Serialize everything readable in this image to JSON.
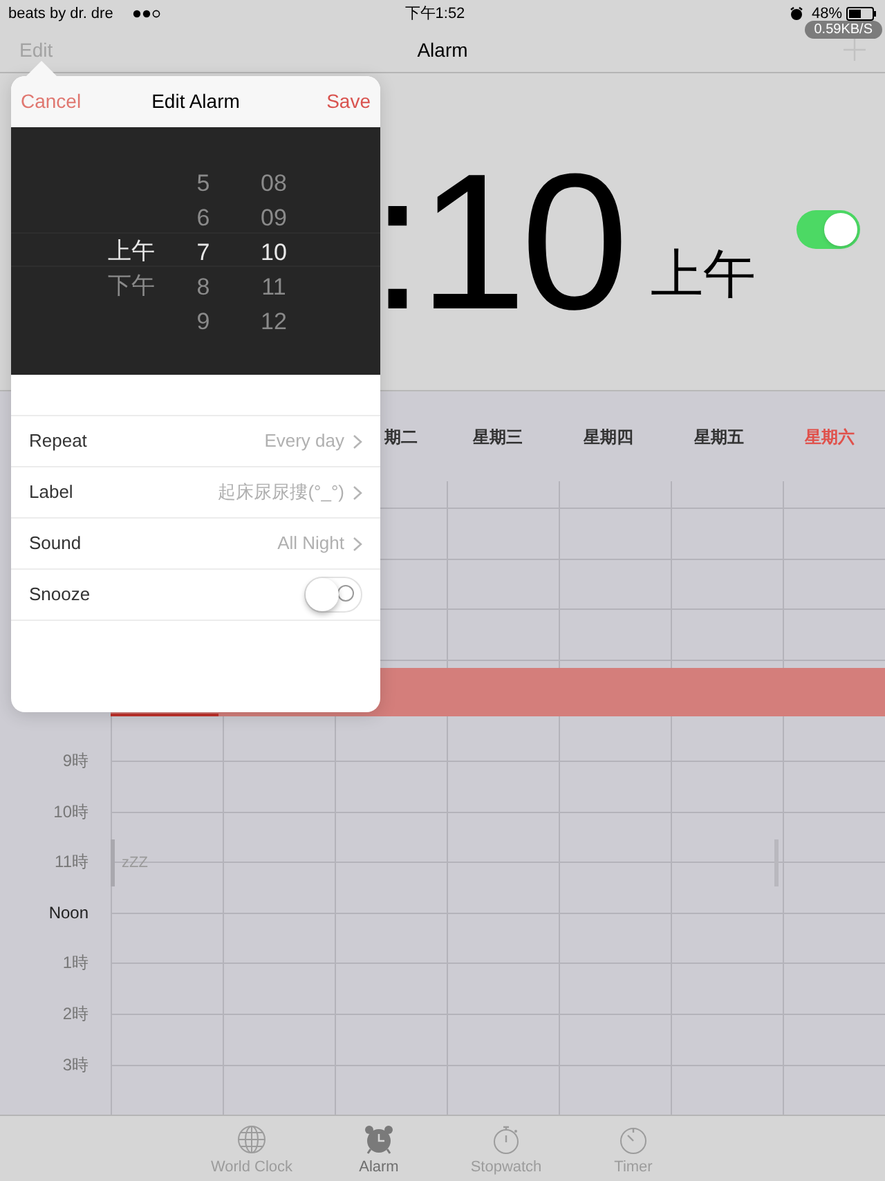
{
  "status_bar": {
    "carrier": "beats by dr. dre",
    "time": "下午1:52",
    "battery": "48%",
    "network_speed": "0.59KB/S"
  },
  "nav_bar": {
    "edit": "Edit",
    "title": "Alarm"
  },
  "alarm": {
    "time": ":10",
    "period": "上午",
    "on": true
  },
  "schedule": {
    "days": [
      {
        "label": "期二",
        "today": false
      },
      {
        "label": "星期三",
        "today": false
      },
      {
        "label": "星期四",
        "today": false
      },
      {
        "label": "星期五",
        "today": false
      },
      {
        "label": "星期六",
        "today": true
      }
    ],
    "hours": [
      "9時",
      "10時",
      "11時",
      "Noon",
      "1時",
      "2時",
      "3時"
    ],
    "snooze_mark": "zZZ"
  },
  "edit_alarm": {
    "cancel": "Cancel",
    "title": "Edit Alarm",
    "save": "Save",
    "picker": [
      {
        "items": [
          {
            "text": "上午",
            "selected": true
          },
          {
            "text": "下午",
            "selected": false
          }
        ]
      },
      {
        "items": [
          {
            "text": "5",
            "selected": false
          },
          {
            "text": "6",
            "selected": false
          },
          {
            "text": "7",
            "selected": true
          },
          {
            "text": "8",
            "selected": false
          },
          {
            "text": "9",
            "selected": false
          }
        ]
      },
      {
        "items": [
          {
            "text": "08",
            "selected": false
          },
          {
            "text": "09",
            "selected": false
          },
          {
            "text": "10",
            "selected": true
          },
          {
            "text": "11",
            "selected": false
          },
          {
            "text": "12",
            "selected": false
          }
        ]
      }
    ],
    "rows": [
      {
        "kind": "link",
        "label": "Repeat",
        "value": "Every day"
      },
      {
        "kind": "link",
        "label": "Label",
        "value": "起床尿尿摟(°_°)"
      },
      {
        "kind": "link",
        "label": "Sound",
        "value": "All Night"
      },
      {
        "kind": "toggle",
        "label": "Snooze",
        "on": false
      }
    ]
  },
  "tab_bar": [
    {
      "label": "World Clock",
      "selected": false
    },
    {
      "label": "Alarm",
      "selected": true
    },
    {
      "label": "Stopwatch",
      "selected": false
    },
    {
      "label": "Timer",
      "selected": false
    }
  ]
}
